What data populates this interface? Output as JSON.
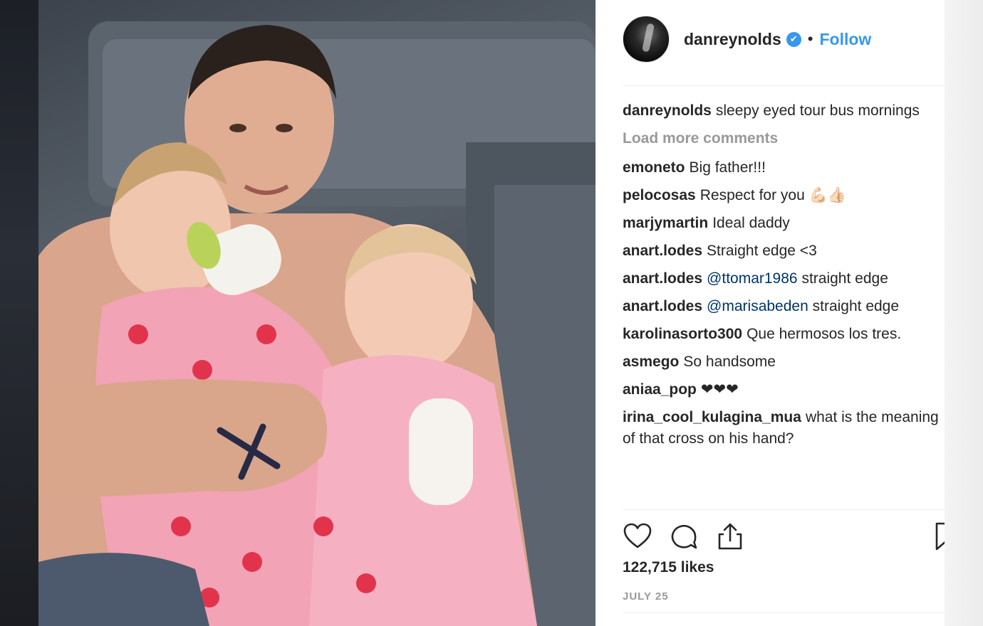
{
  "post": {
    "author": "danreynolds",
    "verified_mark": "✔",
    "separator": "•",
    "follow_label": "Follow",
    "caption_user": "danreynolds",
    "caption_text": "sleepy eyed tour bus mornings",
    "load_more_label": "Load more comments",
    "likes": "122,715 likes",
    "date": "JULY 25"
  },
  "comments": [
    {
      "user": "emoneto",
      "text": "Big father!!!"
    },
    {
      "user": "pelocosas",
      "text": "Respect for you 💪🏻👍🏻"
    },
    {
      "user": "marjymartin",
      "text": "Ideal daddy"
    },
    {
      "user": "anart.lodes",
      "text": "Straight edge <3"
    },
    {
      "user": "anart.lodes",
      "mention": "@ttomar1986",
      "text": "straight edge"
    },
    {
      "user": "anart.lodes",
      "mention": "@marisabeden",
      "text": "straight edge"
    },
    {
      "user": "karolinasorto300",
      "text": "Que hermosos los tres."
    },
    {
      "user": "asmego",
      "text": "So handsome"
    },
    {
      "user": "aniaa_pop",
      "text": "❤❤❤"
    },
    {
      "user": "irina_cool_kulagina_mua",
      "text": "what is the meaning of that cross on his hand?"
    }
  ],
  "icons": {
    "like": "heart-icon",
    "comment": "comment-bubble-icon",
    "share": "share-upload-icon",
    "save": "bookmark-icon"
  },
  "colors": {
    "link_blue": "#3897f0",
    "text": "#262626",
    "muted": "#999999",
    "mention": "#003569"
  }
}
